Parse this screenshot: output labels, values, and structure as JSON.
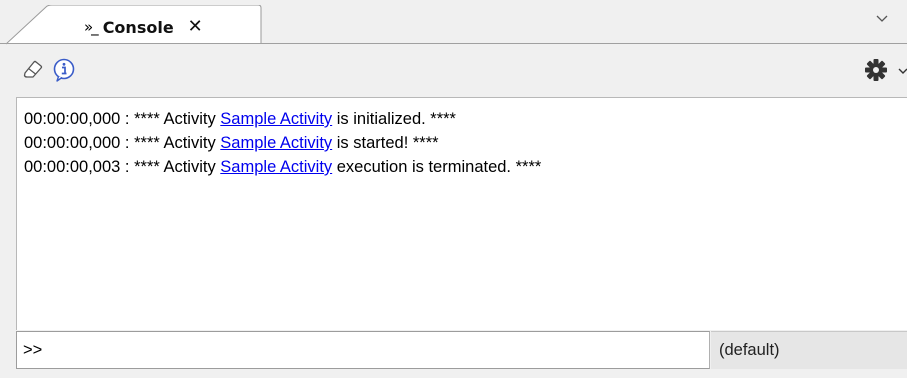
{
  "tab": {
    "icon": "console-icon",
    "icon_glyph": "»_",
    "label": "Console",
    "close_glyph": "✕"
  },
  "toolbar": {
    "icons": [
      "eraser-icon",
      "info-icon",
      "gear-icon",
      "chevron-down-icon"
    ]
  },
  "output": {
    "lines": [
      {
        "time": "00:00:00,000",
        "prefix": " : **** Activity ",
        "link": "Sample Activity",
        "suffix": " is initialized. ****"
      },
      {
        "time": "00:00:00,000",
        "prefix": " : **** Activity ",
        "link": "Sample Activity",
        "suffix": " is started! ****"
      },
      {
        "time": "00:00:00,003",
        "prefix": " : **** Activity ",
        "link": "Sample Activity",
        "suffix": " execution is terminated. ****"
      }
    ],
    "link_color": "#0000ee"
  },
  "command": {
    "prompt": ">>",
    "value": ""
  },
  "context_select": {
    "selected": "(default)"
  }
}
